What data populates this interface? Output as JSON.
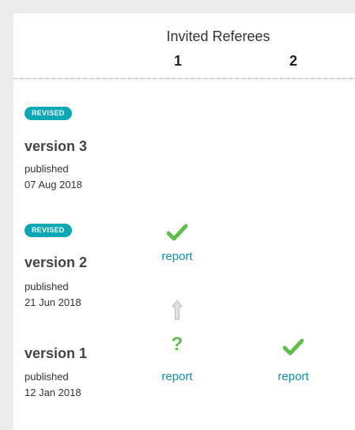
{
  "header": {
    "title": "Invited Referees",
    "referees": [
      "1",
      "2"
    ]
  },
  "versions": [
    {
      "badge": "REVISED",
      "title": "version 3",
      "published_label": "published",
      "date": "07 Aug 2018"
    },
    {
      "badge": "REVISED",
      "title": "version 2",
      "published_label": "published",
      "date": "21 Jun 2018",
      "referee1": {
        "status_icon": "check-icon",
        "link": "report"
      }
    },
    {
      "title": "version 1",
      "published_label": "published",
      "date": "12 Jan 2018",
      "referee1": {
        "status_icon": "question-icon",
        "status_glyph": "?",
        "link": "report"
      },
      "referee2": {
        "status_icon": "check-icon",
        "link": "report"
      }
    }
  ],
  "colors": {
    "badge": "#0aa7b5",
    "link": "#0a93a8",
    "approved": "#5fbe4a",
    "arrow": "#bcbcbc"
  }
}
